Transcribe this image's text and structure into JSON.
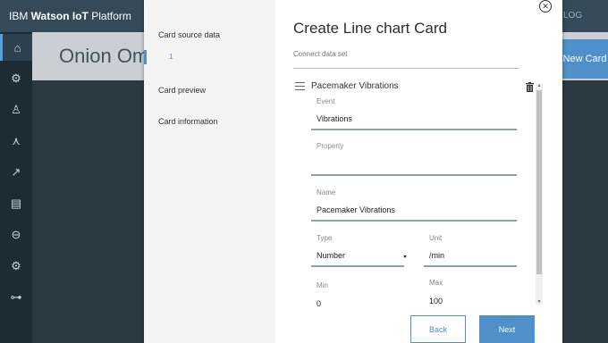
{
  "app": {
    "brand_prefix": "IBM ",
    "brand_bold": "Watson IoT",
    "brand_suffix": " Platform",
    "topbar_right": "LOG"
  },
  "sidebar": {
    "items": [
      {
        "icon": "dashboard-icon",
        "glyph": "⌂"
      },
      {
        "icon": "devices-icon",
        "glyph": "⚙"
      },
      {
        "icon": "members-icon",
        "glyph": "♙"
      },
      {
        "icon": "rules-icon",
        "glyph": "⋏"
      },
      {
        "icon": "analytics-icon",
        "glyph": "↗"
      },
      {
        "icon": "reports-icon",
        "glyph": "▤"
      },
      {
        "icon": "security-icon",
        "glyph": "⊖"
      },
      {
        "icon": "settings-icon",
        "glyph": "⚙"
      },
      {
        "icon": "apps-icon",
        "glyph": "⊶"
      }
    ]
  },
  "dashboard": {
    "title": "Onion Ome",
    "new_card_label": "New Card"
  },
  "dialog": {
    "title": "Create Line chart Card",
    "subtitle": "Connect data set",
    "close_glyph": "✕",
    "steps": [
      {
        "label": "Card source data",
        "index": "1"
      },
      {
        "label": "Card preview"
      },
      {
        "label": "Card information"
      }
    ],
    "dataset": {
      "title": "Pacemaker Vibrations",
      "fields": {
        "event": {
          "label": "Event",
          "value": "Vibrations"
        },
        "property": {
          "label": "Property",
          "value": ""
        },
        "name": {
          "label": "Name",
          "value": "Pacemaker Vibrations"
        },
        "type": {
          "label": "Type",
          "value": "Number"
        },
        "unit": {
          "label": "Unit",
          "value": "/min"
        },
        "min": {
          "label": "Min",
          "value": "0"
        },
        "max": {
          "label": "Max",
          "value": "100"
        }
      }
    },
    "back_label": "Back",
    "next_label": "Next"
  },
  "colors": {
    "accent": "#4f8fca",
    "topbar": "#34495a",
    "sidebar": "#1d2b34"
  }
}
